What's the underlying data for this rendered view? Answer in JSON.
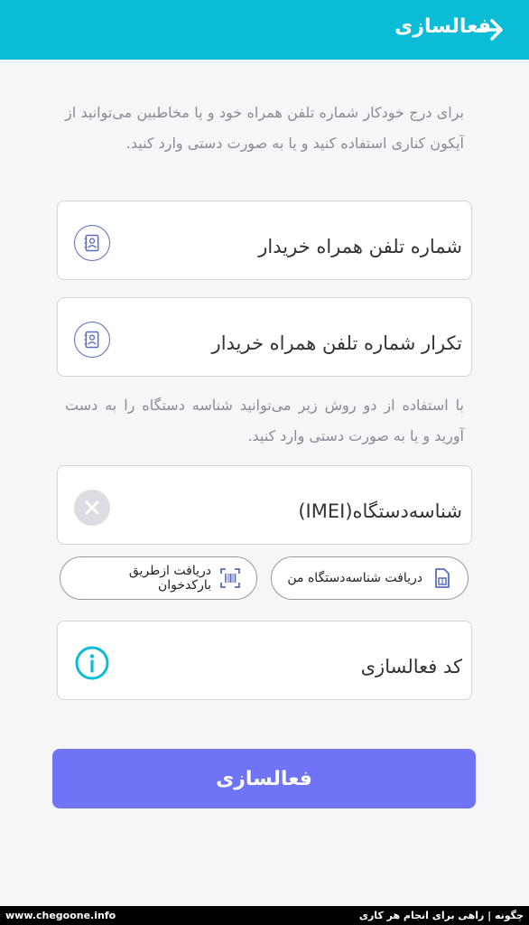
{
  "header": {
    "title": "فعالسازی",
    "back_icon": "arrow-right-icon",
    "color": "#0bbcd6"
  },
  "intro_text": "برای درج خودکار شماره تلفن همراه خود و یا مخاطبین می‌توانید از آیکون کناری استفاده کنید و یا به صورت دستی وارد کنید.",
  "fields": {
    "buyer_phone": {
      "placeholder": "شماره تلفن همراه خریدار",
      "icon": "contact-book-icon"
    },
    "buyer_phone_repeat": {
      "placeholder": "تکرار شماره تلفن همراه خریدار",
      "icon": "contact-book-icon"
    }
  },
  "device_text": "با استفاده از دو روش زیر می‌توانید شناسه دستگاه را به دست آورید و یا به صورت دستی وارد کنید.",
  "imei": {
    "placeholder": "شناسه‌دستگاه(IMEI)",
    "icon": "clear-icon"
  },
  "actions": {
    "get_my_device_id": {
      "label": "دریافت شناسه‌دستگاه من",
      "icon": "sim-card-icon"
    },
    "scan_barcode": {
      "label": "دریافت ازطریق بارکدخوان",
      "icon": "barcode-scan-icon"
    }
  },
  "activation_code": {
    "placeholder": "کد فعالسازی",
    "icon": "info-icon"
  },
  "submit": {
    "label": "فعالسازی",
    "color": "#6f74f7"
  },
  "footer": {
    "left": "www.chegoone.info",
    "right": "چگونه | راهی برای انجام هر کاری"
  }
}
